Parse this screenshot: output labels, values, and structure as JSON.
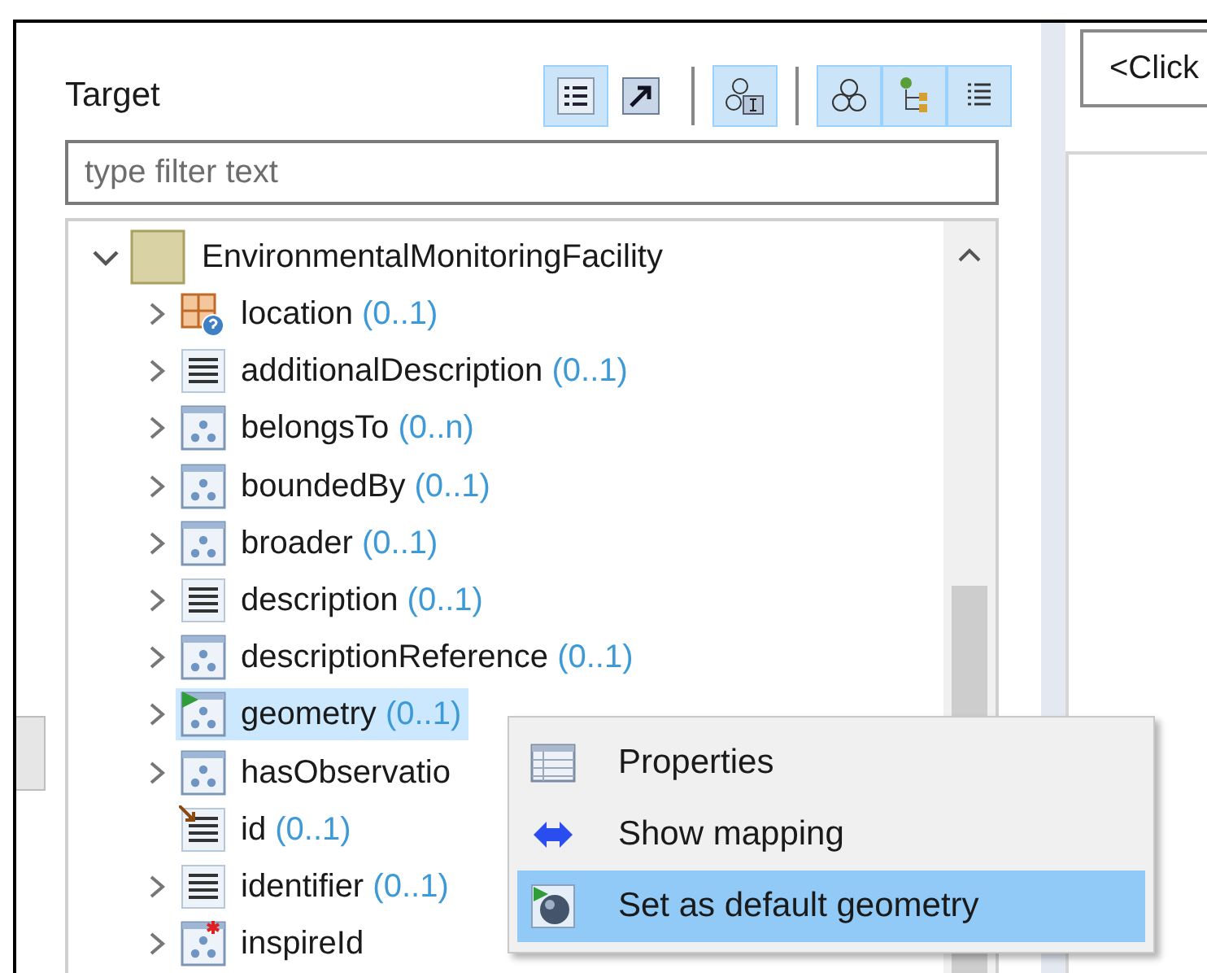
{
  "target_panel": {
    "title": "Target",
    "toolbar": [
      [
        {
          "kind": "outline-list",
          "selected": true
        },
        {
          "kind": "arrow",
          "selected": false
        }
      ],
      [
        {
          "kind": "circles-text",
          "selected": true
        }
      ],
      [
        {
          "kind": "circles",
          "selected": true
        },
        {
          "kind": "tree",
          "selected": true
        },
        {
          "kind": "list",
          "selected": true
        }
      ]
    ],
    "filter": {
      "placeholder": "type filter text"
    },
    "tree": [
      {
        "name": "EnvironmentalMonitoringFacility",
        "kind": "class",
        "expanded": true,
        "selected": false,
        "children": [
          {
            "name": "location",
            "multiplicity": "(0..1)",
            "kind": "geometry",
            "expandable": true,
            "selected": false
          },
          {
            "name": "additionalDescription",
            "multiplicity": "(0..1)",
            "kind": "text",
            "expandable": true,
            "selected": false
          },
          {
            "name": "belongsTo",
            "multiplicity": "(0..n)",
            "kind": "group",
            "expandable": true,
            "selected": false
          },
          {
            "name": "boundedBy",
            "multiplicity": "(0..1)",
            "kind": "group",
            "expandable": true,
            "selected": false
          },
          {
            "name": "broader",
            "multiplicity": "(0..1)",
            "kind": "group",
            "expandable": true,
            "selected": false
          },
          {
            "name": "description",
            "multiplicity": "(0..1)",
            "kind": "text",
            "expandable": true,
            "selected": false
          },
          {
            "name": "descriptionReference",
            "multiplicity": "(0..1)",
            "kind": "group",
            "expandable": true,
            "selected": false
          },
          {
            "name": "geometry",
            "multiplicity": "(0..1)",
            "kind": "default-group",
            "expandable": true,
            "selected": true
          },
          {
            "name": "hasObservatio",
            "kind": "group",
            "expandable": true,
            "selected": false
          },
          {
            "name": "id",
            "multiplicity": "(0..1)",
            "kind": "id",
            "expandable": false,
            "selected": false
          },
          {
            "name": "identifier",
            "multiplicity": "(0..1)",
            "kind": "text",
            "expandable": true,
            "selected": false
          },
          {
            "name": "inspireId",
            "kind": "required-group",
            "expandable": true,
            "selected": false
          }
        ]
      }
    ]
  },
  "context_menu": [
    {
      "label": "Properties",
      "kind": "table",
      "selected": false
    },
    {
      "label": "Show mapping",
      "kind": "double-arrow",
      "selected": false
    },
    {
      "label": "Set as default geometry",
      "kind": "default-geometry",
      "selected": true
    }
  ],
  "right_panel": {
    "field": "<Click"
  }
}
